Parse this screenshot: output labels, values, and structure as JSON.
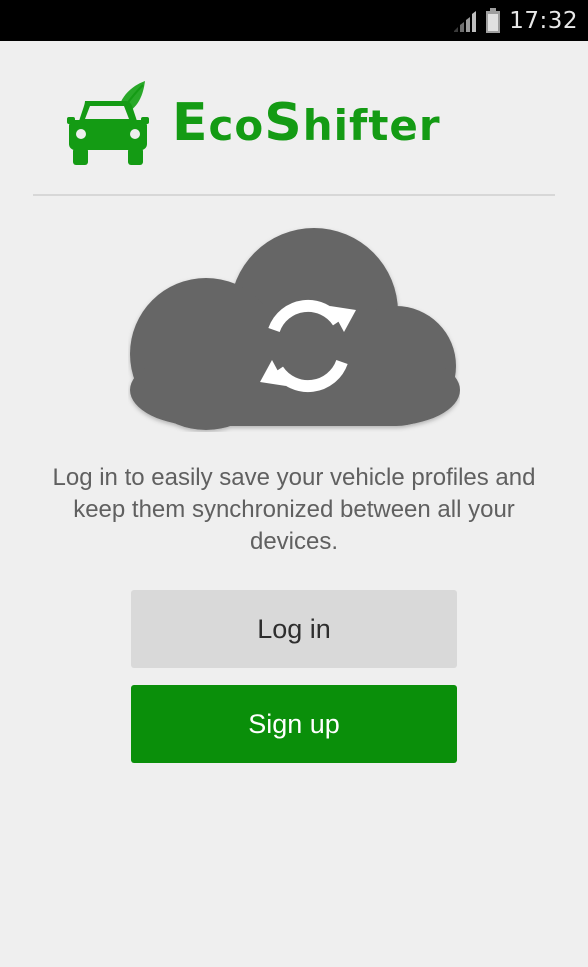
{
  "status_bar": {
    "time": "17:32",
    "signal_icon": "signal-icon",
    "battery_icon": "battery-icon"
  },
  "app": {
    "brand_parts": [
      "E",
      "co",
      "S",
      "hifter"
    ],
    "logo_icon": "car-leaf-icon",
    "accent_color": "#149b14"
  },
  "illustration": {
    "icon": "cloud-sync-icon"
  },
  "description": "Log in to easily save your vehicle profiles and keep them synchronized between all your devices.",
  "buttons": {
    "login_label": "Log in",
    "signup_label": "Sign up",
    "signup_color": "#0a8f0a"
  }
}
